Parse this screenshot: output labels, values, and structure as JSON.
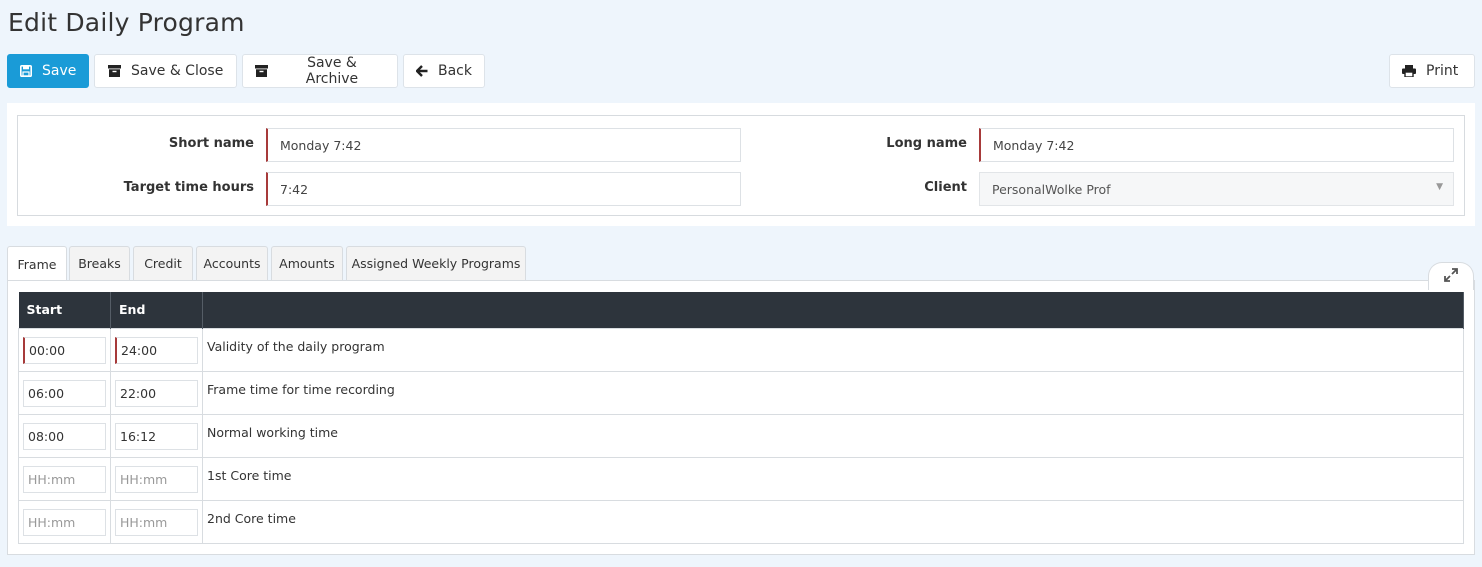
{
  "page": {
    "title": "Edit Daily Program"
  },
  "toolbar": {
    "save_label": "Save",
    "save_close_label": "Save & Close",
    "save_archive_label": "Save & Archive",
    "back_label": "Back",
    "print_label": "Print"
  },
  "form": {
    "short_name_label": "Short name",
    "short_name_value": "Monday 7:42",
    "long_name_label": "Long name",
    "long_name_value": "Monday 7:42",
    "target_hours_label": "Target time hours",
    "target_hours_value": "7:42",
    "client_label": "Client",
    "client_value": "PersonalWolke Prof"
  },
  "tabs": [
    {
      "label": "Frame",
      "active": true
    },
    {
      "label": "Breaks"
    },
    {
      "label": "Credit"
    },
    {
      "label": "Accounts"
    },
    {
      "label": "Amounts"
    },
    {
      "label": "Assigned Weekly Programs"
    }
  ],
  "table": {
    "headers": {
      "start": "Start",
      "end": "End",
      "desc": ""
    },
    "rows": [
      {
        "start": "00:00",
        "end": "24:00",
        "desc": "Validity of the daily program"
      },
      {
        "start": "06:00",
        "end": "22:00",
        "desc": "Frame time for time recording"
      },
      {
        "start": "08:00",
        "end": "16:12",
        "desc": "Normal working time"
      },
      {
        "start": "",
        "end": "",
        "start_placeholder": "HH:mm",
        "end_placeholder": "HH:mm",
        "desc": "1st Core time"
      },
      {
        "start": "",
        "end": "",
        "start_placeholder": "HH:mm",
        "end_placeholder": "HH:mm",
        "desc": "2nd Core time"
      }
    ]
  },
  "colors": {
    "primary": "#1a9bd7",
    "header_bg": "#2d343c",
    "required_marker": "#a73a3a",
    "page_bg": "#eef5fc"
  },
  "icons": {
    "save": "floppy-icon",
    "archive": "archive-box-icon",
    "back": "arrow-left-icon",
    "print": "printer-icon",
    "expand": "expand-icon",
    "dropdown": "caret-down-icon"
  }
}
